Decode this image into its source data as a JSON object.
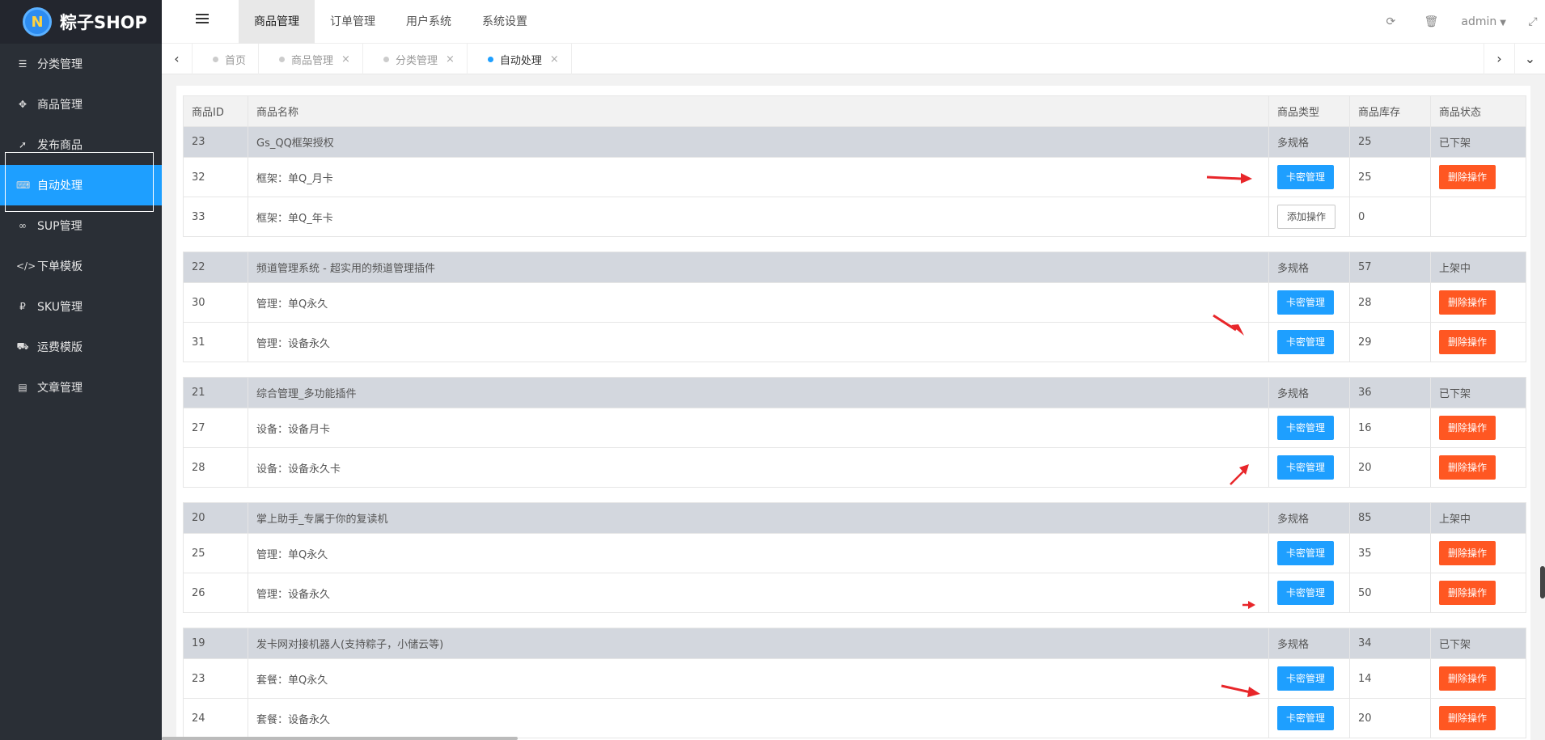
{
  "app": {
    "logo_letter": "N",
    "name": "粽子SHOP"
  },
  "sidebar": {
    "items": [
      {
        "label": "分类管理",
        "icon": "list-icon",
        "glyph": "☰"
      },
      {
        "label": "商品管理",
        "icon": "move-icon",
        "glyph": "✥"
      },
      {
        "label": "发布商品",
        "icon": "rocket-icon",
        "glyph": "➚"
      },
      {
        "label": "自动处理",
        "icon": "keyboard-icon",
        "glyph": "⌨"
      },
      {
        "label": "SUP管理",
        "icon": "link-icon",
        "glyph": "∞"
      },
      {
        "label": "下单模板",
        "icon": "code-icon",
        "glyph": "</>"
      },
      {
        "label": "SKU管理",
        "icon": "ruble-icon",
        "glyph": "₽"
      },
      {
        "label": "运费模版",
        "icon": "truck-icon",
        "glyph": "⛟"
      },
      {
        "label": "文章管理",
        "icon": "book-icon",
        "glyph": "▤"
      }
    ],
    "active_index": 3
  },
  "header": {
    "tabs": [
      "商品管理",
      "订单管理",
      "用户系统",
      "系统设置"
    ],
    "active_index": 0,
    "refresh_icon": "⟳",
    "trash_icon": "🗑",
    "user": "admin",
    "caret": "▼",
    "fullscreen_icon": "⤢"
  },
  "tabstrip": {
    "left_arrow": "‹",
    "right_arrow": "›",
    "down_arrow": "⌄",
    "tabs": [
      {
        "label": "首页",
        "closable": false
      },
      {
        "label": "商品管理",
        "closable": true
      },
      {
        "label": "分类管理",
        "closable": true
      },
      {
        "label": "自动处理",
        "closable": true
      }
    ],
    "close_glyph": "×",
    "active_index": 3
  },
  "table": {
    "headers": [
      "商品ID",
      "商品名称",
      "商品类型",
      "商品库存",
      "商品状态"
    ],
    "groups": [
      {
        "id": "23",
        "name": "Gs_QQ框架授权",
        "type": "多规格",
        "stock": "25",
        "status": "已下架",
        "status_kind": "off",
        "items": [
          {
            "id": "32",
            "name": "框架：单Q_月卡",
            "action": "卡密管理",
            "action_kind": "blue",
            "stock": "25",
            "op": "删除操作"
          },
          {
            "id": "33",
            "name": "框架：单Q_年卡",
            "action": "添加操作",
            "action_kind": "white",
            "stock": "0",
            "op": ""
          }
        ]
      },
      {
        "id": "22",
        "name": "频道管理系统 - 超实用的频道管理插件",
        "type": "多规格",
        "stock": "57",
        "status": "上架中",
        "status_kind": "on",
        "items": [
          {
            "id": "30",
            "name": "管理：单Q永久",
            "action": "卡密管理",
            "action_kind": "blue",
            "stock": "28",
            "op": "删除操作"
          },
          {
            "id": "31",
            "name": "管理：设备永久",
            "action": "卡密管理",
            "action_kind": "blue",
            "stock": "29",
            "op": "删除操作"
          }
        ]
      },
      {
        "id": "21",
        "name": "综合管理_多功能插件",
        "type": "多规格",
        "stock": "36",
        "status": "已下架",
        "status_kind": "off",
        "items": [
          {
            "id": "27",
            "name": "设备：设备月卡",
            "action": "卡密管理",
            "action_kind": "blue",
            "stock": "16",
            "op": "删除操作"
          },
          {
            "id": "28",
            "name": "设备：设备永久卡",
            "action": "卡密管理",
            "action_kind": "blue",
            "stock": "20",
            "op": "删除操作"
          }
        ]
      },
      {
        "id": "20",
        "name": "掌上助手_专属于你的复读机",
        "type": "多规格",
        "stock": "85",
        "status": "上架中",
        "status_kind": "on",
        "items": [
          {
            "id": "25",
            "name": "管理：单Q永久",
            "action": "卡密管理",
            "action_kind": "blue",
            "stock": "35",
            "op": "删除操作"
          },
          {
            "id": "26",
            "name": "管理：设备永久",
            "action": "卡密管理",
            "action_kind": "blue",
            "stock": "50",
            "op": "删除操作"
          }
        ]
      },
      {
        "id": "19",
        "name": "发卡网对接机器人(支持粽子，小储云等)",
        "type": "多规格",
        "stock": "34",
        "status": "已下架",
        "status_kind": "off",
        "items": [
          {
            "id": "23",
            "name": "套餐：单Q永久",
            "action": "卡密管理",
            "action_kind": "blue",
            "stock": "14",
            "op": "删除操作"
          },
          {
            "id": "24",
            "name": "套餐：设备永久",
            "action": "卡密管理",
            "action_kind": "blue",
            "stock": "20",
            "op": "删除操作"
          }
        ]
      }
    ]
  },
  "colors": {
    "accent": "#1e9fff",
    "danger": "#ff5722",
    "sidebar": "#2a2f36",
    "status_off": "#ff2d2d",
    "status_on": "#0c8a1e",
    "annotation": "#e8262a"
  }
}
